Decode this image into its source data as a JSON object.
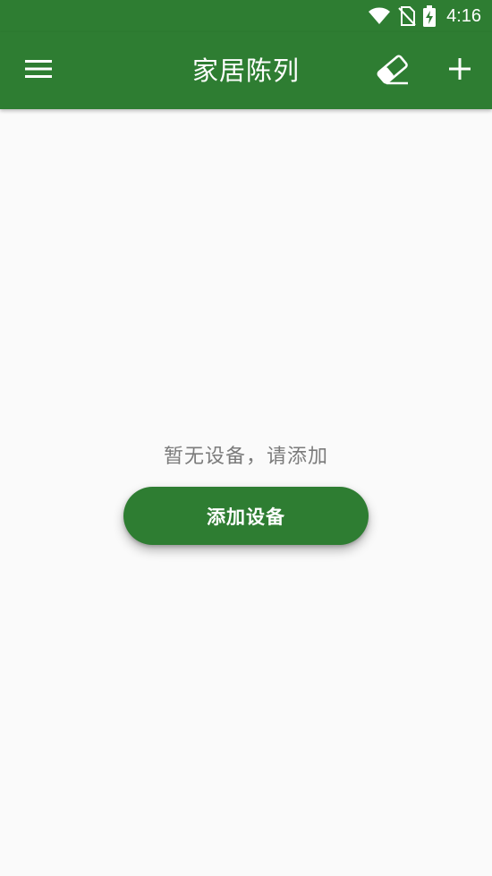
{
  "status_bar": {
    "time": "4:16",
    "icons": [
      "wifi-icon",
      "no-sim-icon",
      "battery-charging-icon"
    ]
  },
  "app_bar": {
    "title": "家居陈列",
    "left_icon": "menu-icon",
    "right_icons": [
      "eraser-icon",
      "plus-icon"
    ]
  },
  "empty_state": {
    "message": "暂无设备，请添加",
    "button_label": "添加设备"
  },
  "colors": {
    "primary": "#2e7d32",
    "background": "#fafafa",
    "text_secondary": "#7b7b7b",
    "on_primary": "#ffffff"
  }
}
